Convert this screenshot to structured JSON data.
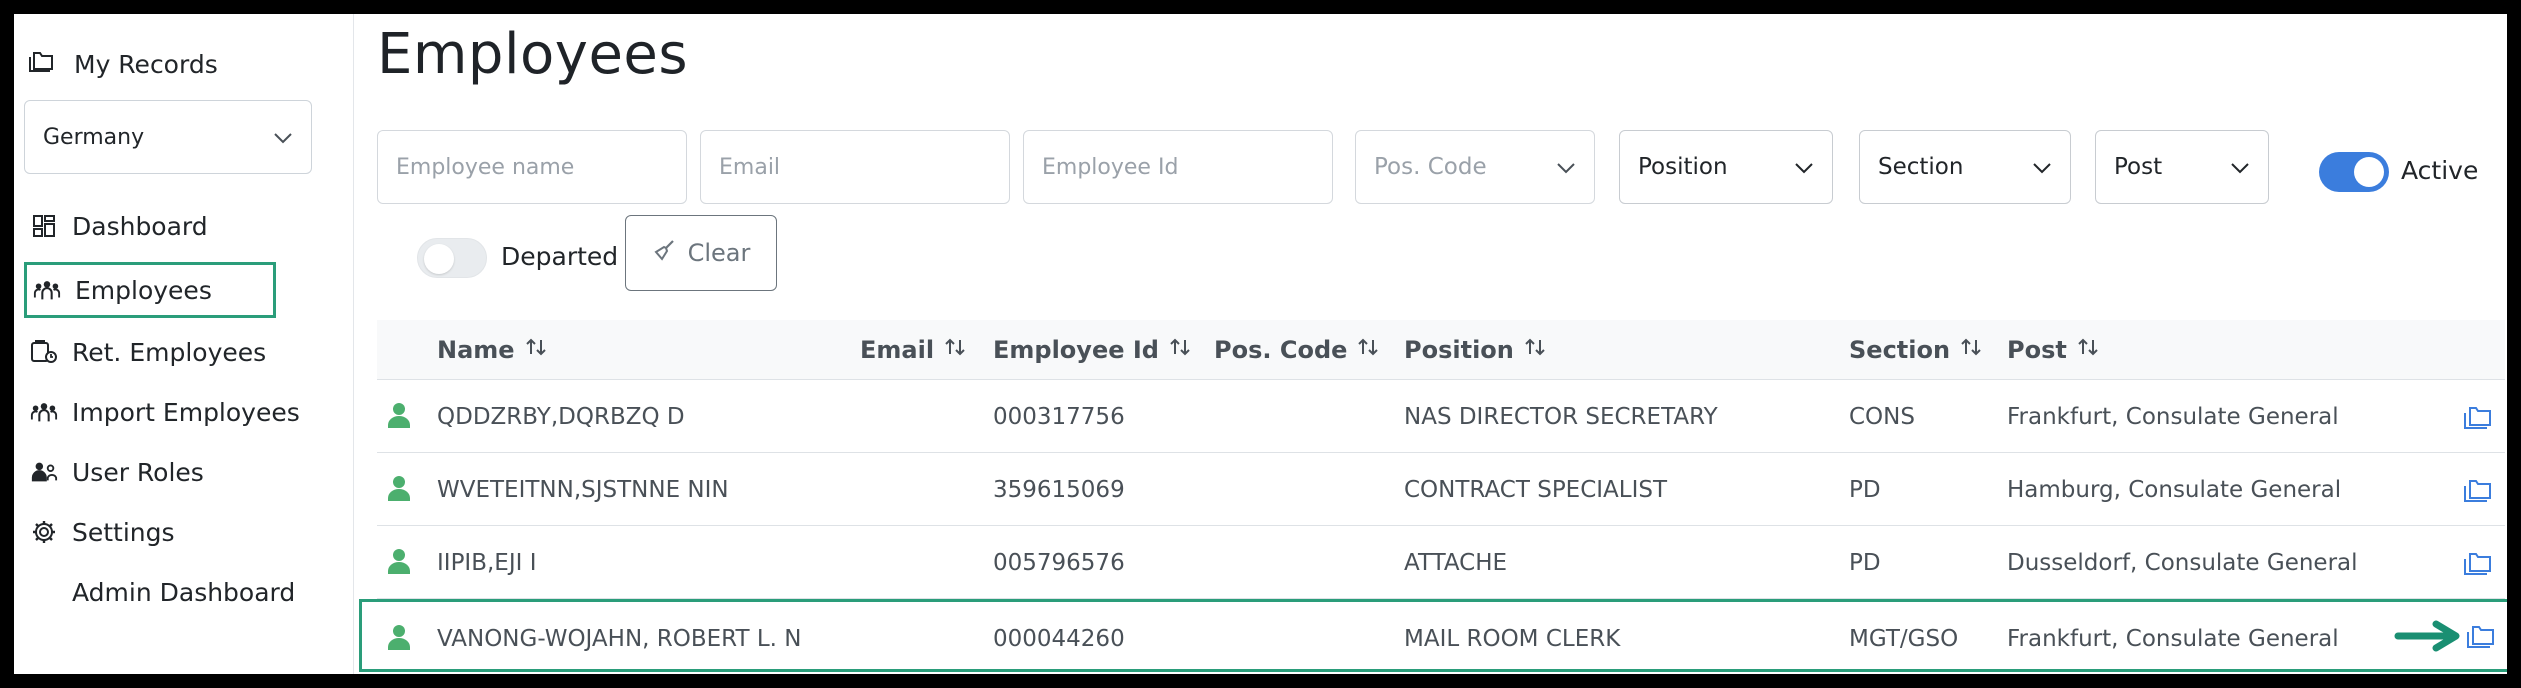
{
  "sidebar": {
    "my_records": "My Records",
    "country": "Germany",
    "items": [
      {
        "label": "Dashboard",
        "icon": "dashboard-icon"
      },
      {
        "label": "Employees",
        "icon": "people-icon",
        "active": true
      },
      {
        "label": "Ret. Employees",
        "icon": "retired-employees-icon"
      },
      {
        "label": "Import Employees",
        "icon": "import-people-icon"
      },
      {
        "label": "User Roles",
        "icon": "user-roles-icon"
      },
      {
        "label": "Settings",
        "icon": "gear-icon"
      },
      {
        "label": "Admin Dashboard",
        "icon": ""
      }
    ]
  },
  "main": {
    "title": "Employees",
    "filters": {
      "employee_name_placeholder": "Employee name",
      "email_placeholder": "Email",
      "employee_id_placeholder": "Employee Id",
      "pos_code": "Pos. Code",
      "position": "Position",
      "section": "Section",
      "post": "Post",
      "active_label": "Active",
      "departed_label": "Departed",
      "clear_label": "Clear"
    },
    "columns": {
      "name": "Name",
      "email": "Email",
      "employee_id": "Employee Id",
      "pos_code": "Pos. Code",
      "position": "Position",
      "section": "Section",
      "post": "Post"
    },
    "rows": [
      {
        "name": "QDDZRBY,DQRBZQ D",
        "email": "",
        "employee_id": "000317756",
        "pos_code": "",
        "position": "NAS DIRECTOR SECRETARY",
        "section": "CONS",
        "post": "Frankfurt, Consulate General"
      },
      {
        "name": "WVETEITNN,SJSTNNE NIN",
        "email": "",
        "employee_id": "359615069",
        "pos_code": "",
        "position": "CONTRACT SPECIALIST",
        "section": "PD",
        "post": "Hamburg, Consulate General"
      },
      {
        "name": "IIPIB,EJI I",
        "email": "",
        "employee_id": "005796576",
        "pos_code": "",
        "position": "ATTACHE",
        "section": "PD",
        "post": "Dusseldorf, Consulate General"
      },
      {
        "name": "VANONG-WOJAHN, ROBERT L. N",
        "email": "",
        "employee_id": "000044260",
        "pos_code": "",
        "position": "MAIL ROOM CLERK",
        "section": "MGT/GSO",
        "post": "Frankfurt, Consulate General"
      }
    ]
  },
  "colors": {
    "accent": "#3b7ddd",
    "highlight": "#2a9d7a",
    "person": "#4caf6e"
  }
}
